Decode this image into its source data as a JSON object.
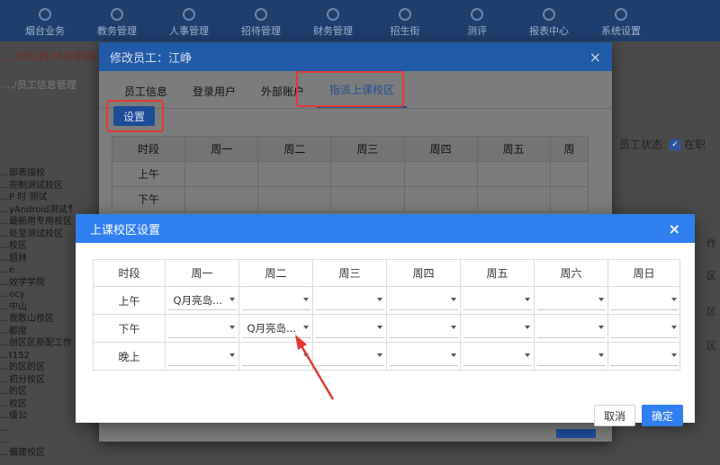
{
  "topnav": {
    "items": [
      "烟台业务",
      "教务管理",
      "人事管理",
      "招待管理",
      "财务管理",
      "招生街",
      "测评",
      "报表中心",
      "系统设置"
    ]
  },
  "background": {
    "notice": "…2年2月26日到期（已…",
    "breadcrumb": "…/员工信息管理",
    "tree": [
      "…部表描校",
      "…完制测试校区",
      "…P 时 测试",
      "…yAndroid测试专区",
      "…最新用专用校区",
      "…处至测试校区",
      "…校区",
      "…题林",
      "…e",
      "…效学学院",
      "…ocy",
      "…中山",
      "…我数山校区",
      "…都度",
      "…创区区新配工作区",
      "…t152",
      "…的区的区",
      "…初分校区",
      "…的区",
      "…校区",
      "…级公",
      "…",
      "…",
      "…偏建校区"
    ],
    "status_label": "员工状态:",
    "status_value": "在职",
    "right_labels": [
      "作",
      "区",
      "区",
      "区"
    ]
  },
  "dialog1": {
    "title": "修改员工：江峥",
    "tabs": [
      "员工信息",
      "登录用户",
      "外部账户",
      "指派上课校区"
    ],
    "active_tab": 3,
    "set_button": "设置",
    "table_headers": [
      "时段",
      "周一",
      "周二",
      "周三",
      "周四",
      "周五",
      "周"
    ],
    "rows": [
      "上午",
      "下午"
    ]
  },
  "dialog2": {
    "title": "上课校区设置",
    "close": "×",
    "headers": [
      "时段",
      "周一",
      "周二",
      "周三",
      "周四",
      "周五",
      "周六",
      "周日"
    ],
    "rows": [
      {
        "period": "上午",
        "cells": [
          "Q月亮岛...",
          "",
          "",
          "",
          "",
          "",
          ""
        ]
      },
      {
        "period": "下午",
        "cells": [
          "",
          "Q月亮岛...",
          "",
          "",
          "",
          "",
          ""
        ]
      },
      {
        "period": "晚上",
        "cells": [
          "",
          "",
          "",
          "",
          "",
          "",
          ""
        ]
      }
    ],
    "cancel": "取消",
    "confirm": "确定"
  },
  "colors": {
    "primary": "#2f7ff0",
    "highlight": "#e53935"
  }
}
